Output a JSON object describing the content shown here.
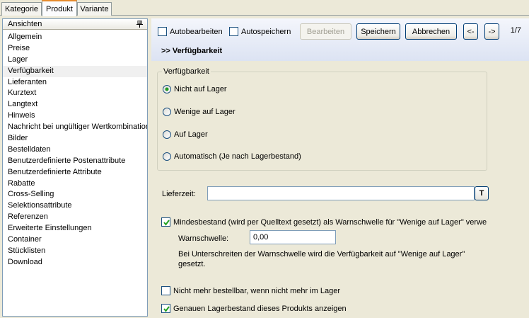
{
  "tabs": [
    {
      "label": "Kategorie"
    },
    {
      "label": "Produkt"
    },
    {
      "label": "Variante"
    }
  ],
  "sidebar": {
    "title": "Ansichten",
    "items": [
      {
        "label": "Allgemein"
      },
      {
        "label": "Preise"
      },
      {
        "label": "Lager"
      },
      {
        "label": "Verfügbarkeit"
      },
      {
        "label": "Lieferanten"
      },
      {
        "label": "Kurztext"
      },
      {
        "label": "Langtext"
      },
      {
        "label": "Hinweis"
      },
      {
        "label": "Nachricht bei ungültiger Wertkombination"
      },
      {
        "label": "Bilder"
      },
      {
        "label": "Bestelldaten"
      },
      {
        "label": "Benutzerdefinierte Postenattribute"
      },
      {
        "label": "Benutzerdefinierte Attribute"
      },
      {
        "label": "Rabatte"
      },
      {
        "label": "Cross-Selling"
      },
      {
        "label": "Selektionsattribute"
      },
      {
        "label": "Referenzen"
      },
      {
        "label": "Erweiterte Einstellungen"
      },
      {
        "label": "Container"
      },
      {
        "label": "Stücklisten"
      },
      {
        "label": "Download"
      }
    ]
  },
  "toolbar": {
    "autobearbeiten": "Autobearbeiten",
    "autospeichern": "Autospeichern",
    "bearbeiten": "Bearbeiten",
    "speichern": "Speichern",
    "abbrechen": "Abbrechen",
    "prev": "<-",
    "next": "->",
    "page": "1/7"
  },
  "section": {
    "title": ">> Verfügbarkeit"
  },
  "availability": {
    "legend": "Verfügbarkeit",
    "options": [
      {
        "label": "Nicht auf Lager",
        "selected": true
      },
      {
        "label": "Wenige auf Lager",
        "selected": false
      },
      {
        "label": "Auf Lager",
        "selected": false
      },
      {
        "label": "Automatisch (Je nach Lagerbestand)",
        "selected": false
      }
    ]
  },
  "lieferzeit": {
    "label": "Lieferzeit:",
    "value": "",
    "t_button": "T"
  },
  "mindestbestand": {
    "label": "Mindesbestand (wird per Quelltext gesetzt) als Warnschwelle für \"Wenige auf Lager\" verwenden",
    "checked": true
  },
  "warnschwelle": {
    "label": "Warnschwelle:",
    "value": "0,00",
    "hint_line1": "Bei Unterschreiten der Warnschwelle wird die Verfügbarkeit auf \"Wenige auf Lager\"",
    "hint_line2": "gesetzt."
  },
  "nicht_bestellbar": {
    "label": "Nicht mehr bestellbar, wenn nicht mehr im Lager",
    "checked": false
  },
  "genauer_bestand": {
    "label": "Genauen Lagerbestand dieses Produkts anzeigen",
    "checked": true
  },
  "colors": {
    "window_bg": "#ece9d8",
    "toolbar_gradient_top": "#f4f6fc",
    "toolbar_gradient_bottom": "#dce3f3",
    "active_tab_accent": "#e68b2c",
    "radio_dot": "#21a121",
    "checkmark": "#21a121"
  }
}
